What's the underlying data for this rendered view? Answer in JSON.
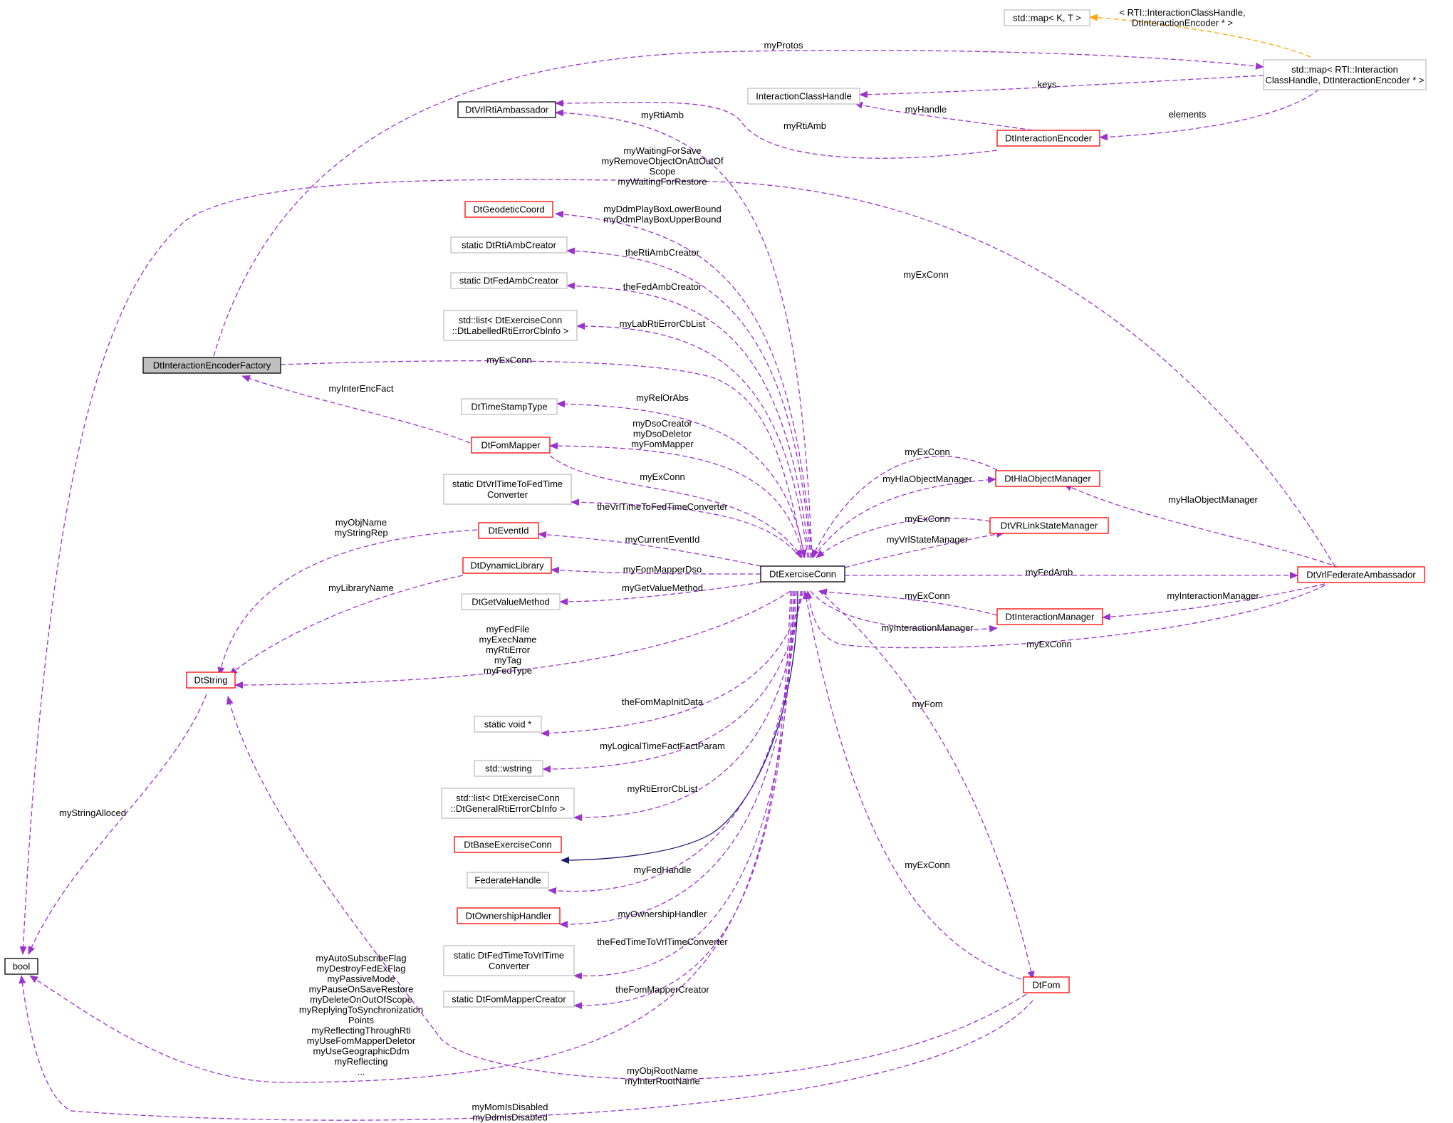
{
  "colors": {
    "usage": "#9a32cd",
    "inherit": "#191970",
    "template": "#ffa500",
    "red_border": "#ff0000",
    "gray_border": "#bfbfbf",
    "black_border": "#000000",
    "focus_fill": "#bfbfbf"
  },
  "nodes": [
    {
      "id": "stdmapKT",
      "lines": [
        "std::map< K, T >"
      ],
      "style": "gray"
    },
    {
      "id": "stdmapRTI",
      "lines": [
        "std::map< RTI::Interaction",
        "ClassHandle, DtInteractionEncoder * >"
      ],
      "style": "gray"
    },
    {
      "id": "ICHandle",
      "lines": [
        "InteractionClassHandle"
      ],
      "style": "gray"
    },
    {
      "id": "VrlRtiAmb",
      "lines": [
        "DtVrlRtiAmbassador"
      ],
      "style": "black"
    },
    {
      "id": "IntEncoder",
      "lines": [
        "DtInteractionEncoder"
      ],
      "style": "red"
    },
    {
      "id": "GeoCoord",
      "lines": [
        "DtGeodeticCoord"
      ],
      "style": "red"
    },
    {
      "id": "RtiAmbCreator",
      "lines": [
        "static DtRtiAmbCreator"
      ],
      "style": "gray"
    },
    {
      "id": "FedAmbCreator",
      "lines": [
        "static DtFedAmbCreator"
      ],
      "style": "gray"
    },
    {
      "id": "listLabelled",
      "lines": [
        "std::list< DtExerciseConn",
        "::DtLabelledRtiErrorCbInfo >"
      ],
      "style": "gray"
    },
    {
      "id": "IEF",
      "lines": [
        "DtInteractionEncoderFactory"
      ],
      "style": "focus"
    },
    {
      "id": "TimeStamp",
      "lines": [
        "DtTimeStampType"
      ],
      "style": "gray"
    },
    {
      "id": "FomMapper",
      "lines": [
        "DtFomMapper"
      ],
      "style": "red"
    },
    {
      "id": "VrlToFed",
      "lines": [
        "static DtVrlTimeToFedTime",
        "Converter"
      ],
      "style": "gray"
    },
    {
      "id": "EventId",
      "lines": [
        "DtEventId"
      ],
      "style": "red"
    },
    {
      "id": "DynLib",
      "lines": [
        "DtDynamicLibrary"
      ],
      "style": "red"
    },
    {
      "id": "GetValue",
      "lines": [
        "DtGetValueMethod"
      ],
      "style": "gray"
    },
    {
      "id": "DtString",
      "lines": [
        "DtString"
      ],
      "style": "red"
    },
    {
      "id": "ExConn",
      "lines": [
        "DtExerciseConn"
      ],
      "style": "black"
    },
    {
      "id": "HlaObjMgr",
      "lines": [
        "DtHlaObjectManager"
      ],
      "style": "red"
    },
    {
      "id": "VRLink",
      "lines": [
        "DtVRLinkStateManager"
      ],
      "style": "red"
    },
    {
      "id": "FedAmb",
      "lines": [
        "DtVrlFederateAmbassador"
      ],
      "style": "red"
    },
    {
      "id": "IntMgr",
      "lines": [
        "DtInteractionManager"
      ],
      "style": "red"
    },
    {
      "id": "voidp",
      "lines": [
        "static void *"
      ],
      "style": "gray"
    },
    {
      "id": "wstring",
      "lines": [
        "std::wstring"
      ],
      "style": "gray"
    },
    {
      "id": "listGeneral",
      "lines": [
        "std::list< DtExerciseConn",
        "::DtGeneralRtiErrorCbInfo >"
      ],
      "style": "gray"
    },
    {
      "id": "BaseEx",
      "lines": [
        "DtBaseExerciseConn"
      ],
      "style": "red"
    },
    {
      "id": "FedHandle",
      "lines": [
        "FederateHandle"
      ],
      "style": "gray"
    },
    {
      "id": "Ownership",
      "lines": [
        "DtOwnershipHandler"
      ],
      "style": "red"
    },
    {
      "id": "FedToVrl",
      "lines": [
        "static DtFedTimeToVrlTime",
        "Converter"
      ],
      "style": "gray"
    },
    {
      "id": "FomMapperCreator",
      "lines": [
        "static DtFomMapperCreator"
      ],
      "style": "gray"
    },
    {
      "id": "DtFom",
      "lines": [
        "DtFom"
      ],
      "style": "red"
    },
    {
      "id": "bool",
      "lines": [
        "bool"
      ],
      "style": "black"
    }
  ],
  "edges": [
    {
      "id": "tmpl",
      "lines": [
        "< RTI::InteractionClassHandle,",
        "DtInteractionEncoder * >"
      ],
      "kind": "template"
    },
    {
      "id": "myProtos",
      "lines": [
        "myProtos"
      ],
      "kind": "usage"
    },
    {
      "id": "keys",
      "lines": [
        "keys"
      ],
      "kind": "usage"
    },
    {
      "id": "elements",
      "lines": [
        "elements"
      ],
      "kind": "usage"
    },
    {
      "id": "myHandle",
      "lines": [
        "myHandle"
      ],
      "kind": "usage"
    },
    {
      "id": "myRtiAmb1",
      "lines": [
        "myRtiAmb"
      ],
      "kind": "usage"
    },
    {
      "id": "myRtiAmb2",
      "lines": [
        "myRtiAmb"
      ],
      "kind": "usage"
    },
    {
      "id": "waiting",
      "lines": [
        "myWaitingForSave",
        "myRemoveObjectOnAttOutOf",
        "Scope",
        "myWaitingForRestore"
      ],
      "kind": "usage"
    },
    {
      "id": "ddmBox",
      "lines": [
        "myDdmPlayBoxLowerBound",
        "myDdmPlayBoxUpperBound"
      ],
      "kind": "usage"
    },
    {
      "id": "theRtiAmbCreator",
      "lines": [
        "theRtiAmbCreator"
      ],
      "kind": "usage"
    },
    {
      "id": "theFedAmbCreator",
      "lines": [
        "theFedAmbCreator"
      ],
      "kind": "usage"
    },
    {
      "id": "labErr",
      "lines": [
        "myLabRtiErrorCbList"
      ],
      "kind": "usage"
    },
    {
      "id": "myExConnTop",
      "lines": [
        "myExConn"
      ],
      "kind": "usage"
    },
    {
      "id": "ief_exconn",
      "lines": [
        "myExConn"
      ],
      "kind": "usage"
    },
    {
      "id": "myInterEncFact",
      "lines": [
        "myInterEncFact"
      ],
      "kind": "usage"
    },
    {
      "id": "relOrAbs",
      "lines": [
        "myRelOrAbs"
      ],
      "kind": "usage"
    },
    {
      "id": "dsoStuff",
      "lines": [
        "myDsoCreator",
        "myDsoDeletor",
        "myFomMapper"
      ],
      "kind": "usage"
    },
    {
      "id": "fm_exconn",
      "lines": [
        "myExConn"
      ],
      "kind": "usage"
    },
    {
      "id": "vrlToFedLbl",
      "lines": [
        "theVrlTimeToFedTimeConverter"
      ],
      "kind": "usage"
    },
    {
      "id": "objName",
      "lines": [
        "myObjName",
        "myStringRep"
      ],
      "kind": "usage"
    },
    {
      "id": "curEvent",
      "lines": [
        "myCurrentEventId"
      ],
      "kind": "usage"
    },
    {
      "id": "fomMapperDso",
      "lines": [
        "myFomMapperDso"
      ],
      "kind": "usage"
    },
    {
      "id": "libName",
      "lines": [
        "myLibraryName"
      ],
      "kind": "usage"
    },
    {
      "id": "getValue",
      "lines": [
        "myGetValueMethod"
      ],
      "kind": "usage"
    },
    {
      "id": "strings",
      "lines": [
        "myFedFile",
        "myExecName",
        "myRtiError",
        "myTag",
        "myFedType"
      ],
      "kind": "usage"
    },
    {
      "id": "hla_exconn",
      "lines": [
        "myExConn"
      ],
      "kind": "usage"
    },
    {
      "id": "hlaMgr",
      "lines": [
        "myHlaObjectManager"
      ],
      "kind": "usage"
    },
    {
      "id": "vrl_exconn",
      "lines": [
        "myExConn"
      ],
      "kind": "usage"
    },
    {
      "id": "vrlState",
      "lines": [
        "myVrlStateManager"
      ],
      "kind": "usage"
    },
    {
      "id": "fedAmbLbl",
      "lines": [
        "myFedAmb"
      ],
      "kind": "usage"
    },
    {
      "id": "fa_hla",
      "lines": [
        "myHlaObjectManager"
      ],
      "kind": "usage"
    },
    {
      "id": "im_exconn",
      "lines": [
        "myExConn"
      ],
      "kind": "usage"
    },
    {
      "id": "intMgrLbl",
      "lines": [
        "myInteractionManager"
      ],
      "kind": "usage"
    },
    {
      "id": "fa_im",
      "lines": [
        "myInteractionManager"
      ],
      "kind": "usage"
    },
    {
      "id": "fa_exconn",
      "lines": [
        "myExConn"
      ],
      "kind": "usage"
    },
    {
      "id": "myFom",
      "lines": [
        "myFom"
      ],
      "kind": "usage"
    },
    {
      "id": "fomMapInit",
      "lines": [
        "theFomMapInitData"
      ],
      "kind": "usage"
    },
    {
      "id": "logTime",
      "lines": [
        "myLogicalTimeFactFactParam"
      ],
      "kind": "usage"
    },
    {
      "id": "rtiErr",
      "lines": [
        "myRtiErrorCbList"
      ],
      "kind": "usage"
    },
    {
      "id": "stringAlloc",
      "lines": [
        "myStringAlloced"
      ],
      "kind": "usage"
    },
    {
      "id": "fedHandleLbl",
      "lines": [
        "myFedHandle"
      ],
      "kind": "usage"
    },
    {
      "id": "fom_exconn",
      "lines": [
        "myExConn"
      ],
      "kind": "usage"
    },
    {
      "id": "ownLbl",
      "lines": [
        "myOwnershipHandler"
      ],
      "kind": "usage"
    },
    {
      "id": "fedToVrlLbl",
      "lines": [
        "theFedTimeToVrlTimeConverter"
      ],
      "kind": "usage"
    },
    {
      "id": "fmcLbl",
      "lines": [
        "theFomMapperCreator"
      ],
      "kind": "usage"
    },
    {
      "id": "boolFlags",
      "lines": [
        "myAutoSubscribeFlag",
        "myDestroyFedExFlag",
        "myPassiveMode",
        "myPauseOnSaveRestore",
        "myDeleteOnOutOfScope",
        "myReplyingToSynchronization",
        "Points",
        "myReflectingThroughRti",
        "myUseFomMapperDeletor",
        "myUseGeographicDdm",
        "myReflecting",
        "..."
      ],
      "kind": "usage"
    },
    {
      "id": "rootName",
      "lines": [
        "myObjRootName",
        "myInterRootName"
      ],
      "kind": "usage"
    },
    {
      "id": "momDdm",
      "lines": [
        "myMomIsDisabled",
        "myDdmIsDisabled"
      ],
      "kind": "usage"
    }
  ]
}
